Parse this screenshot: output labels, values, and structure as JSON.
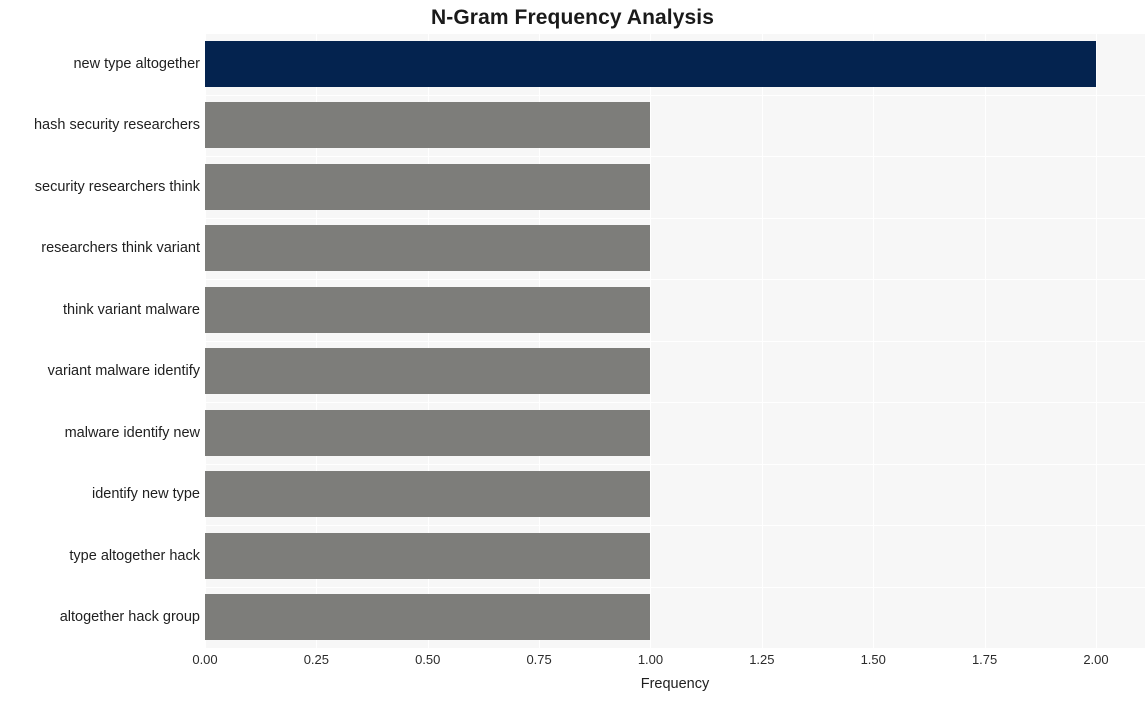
{
  "chart_data": {
    "type": "bar",
    "orientation": "horizontal",
    "title": "N-Gram Frequency Analysis",
    "xlabel": "Frequency",
    "ylabel": "",
    "xlim": [
      0,
      2.11
    ],
    "xticks": [
      "0.00",
      "0.25",
      "0.50",
      "0.75",
      "1.00",
      "1.25",
      "1.50",
      "1.75",
      "2.00"
    ],
    "xtick_values": [
      0,
      0.25,
      0.5,
      0.75,
      1.0,
      1.25,
      1.5,
      1.75,
      2.0
    ],
    "grid": true,
    "legend": "none",
    "categories": [
      "new type altogether",
      "hash security researchers",
      "security researchers think",
      "researchers think variant",
      "think variant malware",
      "variant malware identify",
      "malware identify new",
      "identify new type",
      "type altogether hack",
      "altogether hack group"
    ],
    "values": [
      2,
      1,
      1,
      1,
      1,
      1,
      1,
      1,
      1,
      1
    ],
    "bar_colors": [
      "#04234f",
      "#7d7d7a",
      "#7d7d7a",
      "#7d7d7a",
      "#7d7d7a",
      "#7d7d7a",
      "#7d7d7a",
      "#7d7d7a",
      "#7d7d7a",
      "#7d7d7a"
    ],
    "plot_background": "#f7f7f7",
    "gridline_color": "#ffffff",
    "figure_background": "#ffffff"
  }
}
